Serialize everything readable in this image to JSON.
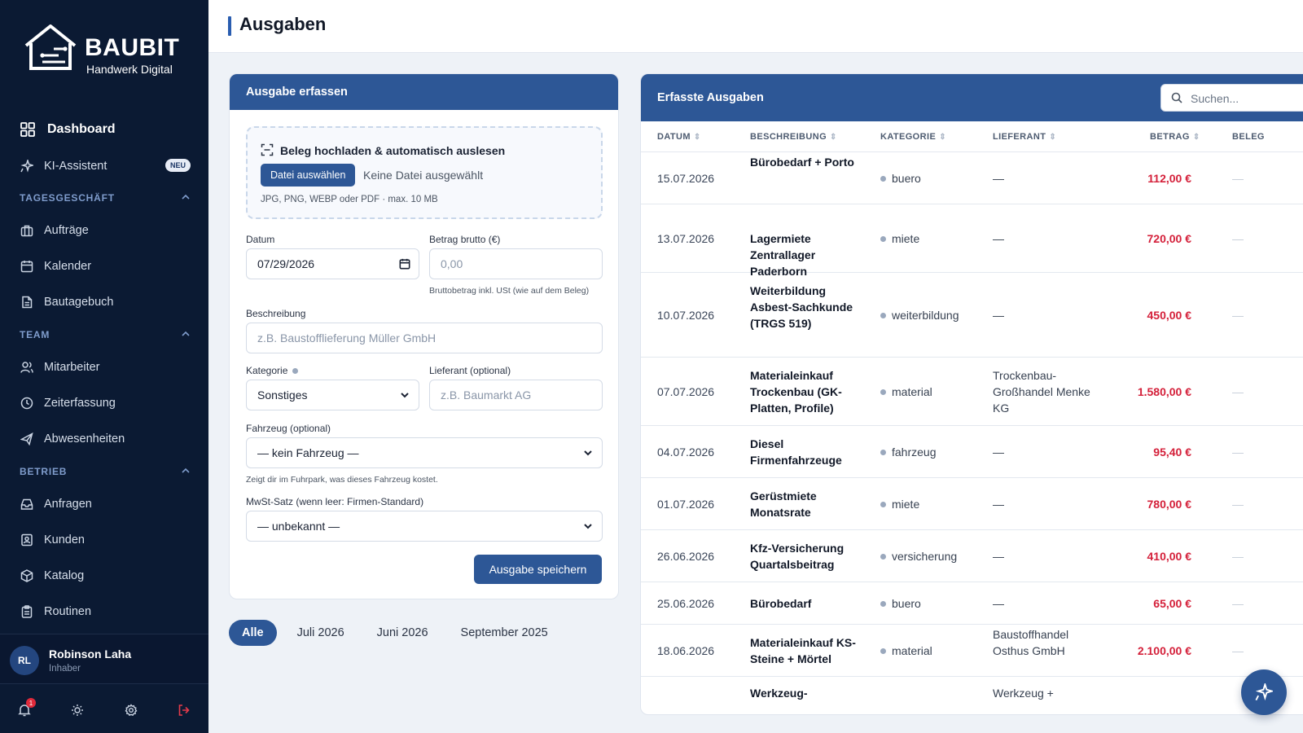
{
  "brand": {
    "name": "BAUBIT",
    "tagline": "Handwerk Digital"
  },
  "sidebar": {
    "dashboard": "Dashboard",
    "ki_assistent": "KI-Assistent",
    "neu_badge": "NEU",
    "sections": {
      "tagesgeschaeft": "TAGESGESCHÄFT",
      "team": "TEAM",
      "betrieb": "BETRIEB"
    },
    "items": {
      "auftraege": "Aufträge",
      "kalender": "Kalender",
      "bautagebuch": "Bautagebuch",
      "mitarbeiter": "Mitarbeiter",
      "zeiterfassung": "Zeiterfassung",
      "abwesenheiten": "Abwesenheiten",
      "anfragen": "Anfragen",
      "kunden": "Kunden",
      "katalog": "Katalog",
      "routinen": "Routinen"
    },
    "user": {
      "initials": "RL",
      "name": "Robinson Laha",
      "role": "Inhaber"
    },
    "notification_count": "1"
  },
  "header": {
    "title": "Ausgaben"
  },
  "form": {
    "title": "Ausgabe erfassen",
    "upload": {
      "title": "Beleg hochladen & automatisch auslesen",
      "button": "Datei auswählen",
      "no_file": "Keine Datei ausgewählt",
      "hint": "JPG, PNG, WEBP oder PDF · max. 10 MB"
    },
    "datum_label": "Datum",
    "datum_value": "07/29/2026",
    "betrag_label": "Betrag brutto (€)",
    "betrag_placeholder": "0,00",
    "betrag_hint": "Bruttobetrag inkl. USt (wie auf dem Beleg)",
    "beschreibung_label": "Beschreibung",
    "beschreibung_placeholder": "z.B. Baustofflieferung Müller GmbH",
    "kategorie_label": "Kategorie",
    "kategorie_value": "Sonstiges",
    "lieferant_label": "Lieferant (optional)",
    "lieferant_placeholder": "z.B. Baumarkt AG",
    "fahrzeug_label": "Fahrzeug (optional)",
    "fahrzeug_value": "— kein Fahrzeug —",
    "fahrzeug_hint": "Zeigt dir im Fuhrpark, was dieses Fahrzeug kostet.",
    "mwst_label": "MwSt-Satz (wenn leer: Firmen-Standard)",
    "mwst_value": "— unbekannt —",
    "save_button": "Ausgabe speichern"
  },
  "filters": [
    "Alle",
    "Juli 2026",
    "Juni 2026",
    "September 2025"
  ],
  "table": {
    "title": "Erfasste Ausgaben",
    "search_placeholder": "Suchen...",
    "columns": [
      "DATUM",
      "BESCHREIBUNG",
      "KATEGORIE",
      "LIEFERANT",
      "BETRAG",
      "BELEG"
    ],
    "rows": [
      {
        "datum": "15.07.2026",
        "beschreibung": "Bürobedarf + Porto",
        "kategorie": "buero",
        "lieferant": "—",
        "betrag": "112,00 €",
        "beleg": "—"
      },
      {
        "datum": "13.07.2026",
        "beschreibung": "Lagermiete Zentrallager Paderborn",
        "kategorie": "miete",
        "lieferant": "—",
        "betrag": "720,00 €",
        "beleg": "—"
      },
      {
        "datum": "10.07.2026",
        "beschreibung": "Weiterbildung Asbest-Sachkunde (TRGS 519)",
        "kategorie": "weiterbildung",
        "lieferant": "—",
        "betrag": "450,00 €",
        "beleg": "—"
      },
      {
        "datum": "07.07.2026",
        "beschreibung": "Materialeinkauf Trockenbau (GK-Platten, Profile)",
        "kategorie": "material",
        "lieferant": "Trockenbau-Großhandel Menke KG",
        "betrag": "1.580,00 €",
        "beleg": "—"
      },
      {
        "datum": "04.07.2026",
        "beschreibung": "Diesel Firmenfahrzeuge",
        "kategorie": "fahrzeug",
        "lieferant": "—",
        "betrag": "95,40 €",
        "beleg": "—"
      },
      {
        "datum": "01.07.2026",
        "beschreibung": "Gerüstmiete Monatsrate",
        "kategorie": "miete",
        "lieferant": "—",
        "betrag": "780,00 €",
        "beleg": "—"
      },
      {
        "datum": "26.06.2026",
        "beschreibung": "Kfz-Versicherung Quartalsbeitrag",
        "kategorie": "versicherung",
        "lieferant": "—",
        "betrag": "410,00 €",
        "beleg": "—"
      },
      {
        "datum": "25.06.2026",
        "beschreibung": "Bürobedarf",
        "kategorie": "buero",
        "lieferant": "—",
        "betrag": "65,00 €",
        "beleg": "—"
      },
      {
        "datum": "18.06.2026",
        "beschreibung": "Materialeinkauf KS-Steine + Mörtel",
        "kategorie": "material",
        "lieferant": "Baustoffhandel Osthus GmbH",
        "betrag": "2.100,00 €",
        "beleg": "—"
      },
      {
        "datum": "",
        "beschreibung": "Werkzeug-",
        "kategorie": "",
        "lieferant": "Werkzeug +",
        "betrag": "",
        "beleg": ""
      }
    ]
  },
  "colors": {
    "sidebar_bg": "#0b1a33",
    "primary": "#2d5796",
    "amount_red": "#d4203a",
    "section_label": "#7f9ccc"
  },
  "icons": {
    "dashboard": "grid-icon",
    "ki": "sparkle-icon",
    "auftraege": "briefcase-icon",
    "kalender": "calendar-icon",
    "bautagebuch": "document-icon",
    "mitarbeiter": "users-icon",
    "zeiterfassung": "clock-icon",
    "abwesenheiten": "plane-icon",
    "anfragen": "inbox-icon",
    "kunden": "contact-icon",
    "katalog": "package-icon",
    "routinen": "clipboard-icon",
    "fab": "sparkle-icon"
  }
}
